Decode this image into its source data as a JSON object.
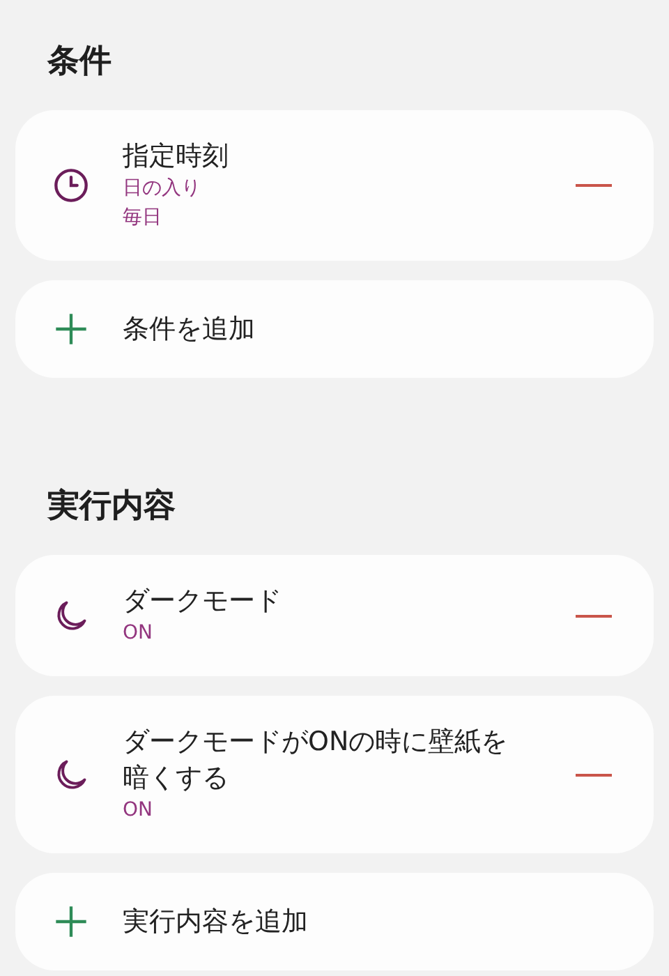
{
  "sections": [
    {
      "title": "条件",
      "items": [
        {
          "kind": "time",
          "title": "指定時刻",
          "details": [
            "日の入り",
            "毎日"
          ]
        }
      ],
      "add_label": "条件を追加"
    },
    {
      "title": "実行内容",
      "items": [
        {
          "kind": "dark_mode",
          "title": "ダークモード",
          "details": [
            "ON"
          ]
        },
        {
          "kind": "dark_mode",
          "title": "ダークモードがONの時に壁紙を暗くする",
          "details": [
            "ON"
          ]
        }
      ],
      "add_label": "実行内容を追加"
    }
  ]
}
